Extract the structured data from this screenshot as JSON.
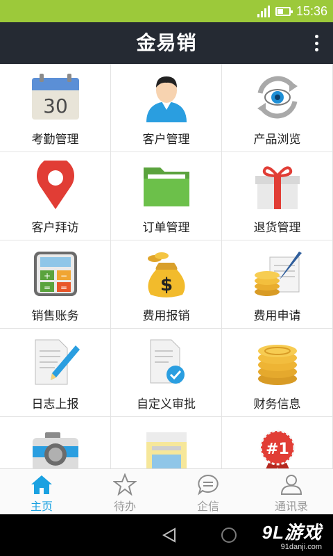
{
  "status_bar": {
    "time": "15:36",
    "color": "#9cc93a"
  },
  "header": {
    "title": "金易销",
    "menu_icon": "more-vertical-icon",
    "color": "#252a33"
  },
  "grid": {
    "items": [
      {
        "label": "考勤管理",
        "icon": "calendar-icon"
      },
      {
        "label": "客户管理",
        "icon": "person-icon"
      },
      {
        "label": "产品浏览",
        "icon": "eye-refresh-icon"
      },
      {
        "label": "客户拜访",
        "icon": "location-pin-icon"
      },
      {
        "label": "订单管理",
        "icon": "folder-icon"
      },
      {
        "label": "退货管理",
        "icon": "gift-icon"
      },
      {
        "label": "销售账务",
        "icon": "calculator-icon"
      },
      {
        "label": "费用报销",
        "icon": "money-bag-icon"
      },
      {
        "label": "费用申请",
        "icon": "coins-pen-icon"
      },
      {
        "label": "日志上报",
        "icon": "document-pencil-icon"
      },
      {
        "label": "自定义审批",
        "icon": "document-check-icon"
      },
      {
        "label": "财务信息",
        "icon": "coin-stack-icon"
      },
      {
        "label": "",
        "icon": "camera-icon"
      },
      {
        "label": "",
        "icon": "folder-window-icon"
      },
      {
        "label": "",
        "icon": "ranking-badge-icon"
      }
    ],
    "calendar_day": "30",
    "badge_text": "#1"
  },
  "tabs": [
    {
      "label": "主页",
      "icon": "home-icon",
      "active": true
    },
    {
      "label": "待办",
      "icon": "star-icon",
      "active": false
    },
    {
      "label": "企信",
      "icon": "chat-icon",
      "active": false
    },
    {
      "label": "通讯录",
      "icon": "contact-icon",
      "active": false
    }
  ],
  "accent_color": "#1aa1e1",
  "watermark": {
    "brand": "9L游戏",
    "site": "91danji.com"
  }
}
